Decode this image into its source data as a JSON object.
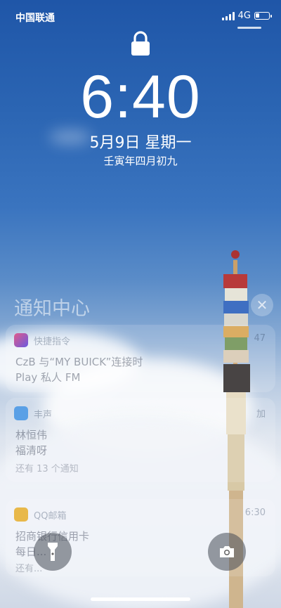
{
  "status_bar": {
    "carrier": "中国联通",
    "network": "4G",
    "signal_bars": 4,
    "battery_level": 0.3,
    "icons": [
      "signal-icon",
      "battery-icon"
    ]
  },
  "lock": {
    "icon": "lock-icon"
  },
  "clock": {
    "time": "6:40",
    "date": "5月9日 星期一",
    "lunar": "壬寅年四月初九"
  },
  "notification_center": {
    "title": "通知中心",
    "close_icon": "close-icon"
  },
  "notifications": [
    {
      "app": "快捷指令",
      "time": "47",
      "lines": [
        "CzB 与“MY BUICK”连接时",
        "Play 私人 FM"
      ]
    },
    {
      "app": "丰声",
      "time": "加",
      "lines": [
        "林恒伟",
        "福清呀"
      ],
      "more": "还有 13 个通知"
    },
    {
      "app": "QQ邮箱",
      "time": "6:30",
      "lines": [
        "招商银行信用卡",
        "每日..."
      ],
      "more": "还有..."
    }
  ],
  "quick_actions": {
    "flashlight": "flashlight-icon",
    "camera": "camera-icon"
  },
  "colors": {
    "sky_top": "#1f56a8",
    "sky_mid": "#5a8cc8",
    "cloud": "#e9edf3"
  }
}
